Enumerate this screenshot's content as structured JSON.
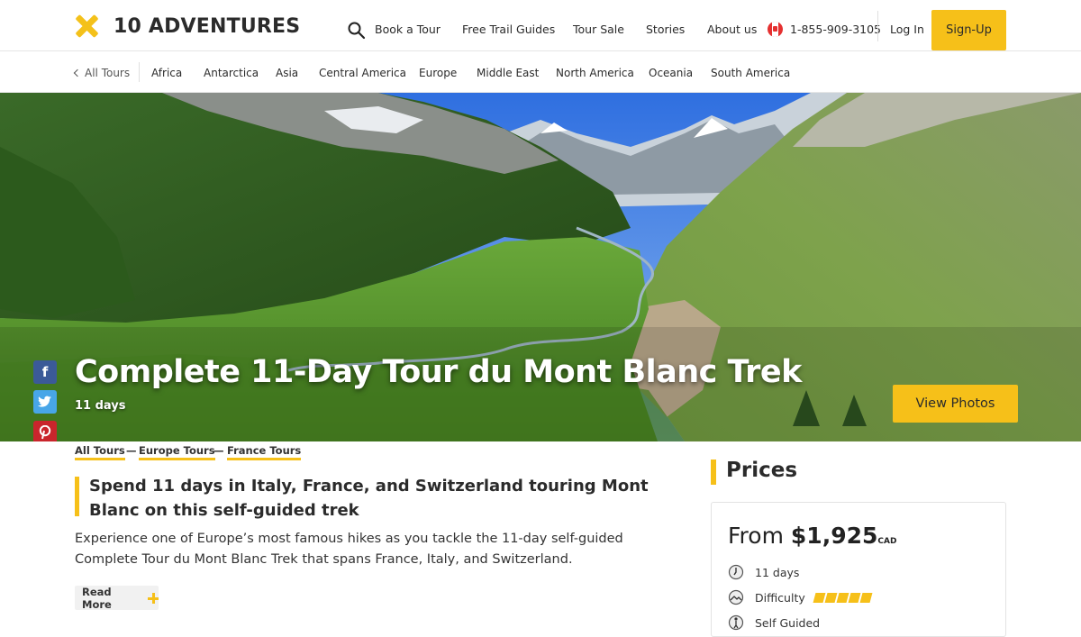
{
  "header": {
    "logo_text": "10 ADVENTURES",
    "nav": [
      "Book a Tour",
      "Free Trail Guides",
      "Tour Sale",
      "Stories",
      "About us"
    ],
    "phone": "1-855-909-3105",
    "login": "Log In",
    "signup": "Sign-Up",
    "brand_color": "#f6c019"
  },
  "subnav": {
    "back": "All Tours",
    "regions": [
      "Africa",
      "Antarctica",
      "Asia",
      "Central America",
      "Europe",
      "Middle East",
      "North America",
      "Oceania",
      "South America"
    ]
  },
  "hero": {
    "title": "Complete 11-Day Tour du Mont Blanc Trek",
    "duration": "11 days",
    "view_photos": "View Photos"
  },
  "social": [
    "facebook-icon",
    "twitter-icon",
    "pinterest-icon"
  ],
  "breadcrumbs": [
    "All Tours",
    "Europe Tours",
    "France Tours"
  ],
  "breadcrumb_separator": "—",
  "lead": "Spend 11 days in Italy, France, and Switzerland touring Mont Blanc on this self-guided trek",
  "description": "Experience one of Europe’s most famous hikes as you tackle the 11-day self-guided Complete Tour du Mont Blanc Trek that spans France, Italy, and Switzerland.",
  "read_more": "Read More",
  "prices": {
    "title": "Prices",
    "from_label": "From",
    "amount": "$1,925",
    "currency": "CAD",
    "duration": "11 days",
    "difficulty_label": "Difficulty",
    "difficulty_level": 5,
    "difficulty_max": 5,
    "guide_type": "Self Guided"
  }
}
